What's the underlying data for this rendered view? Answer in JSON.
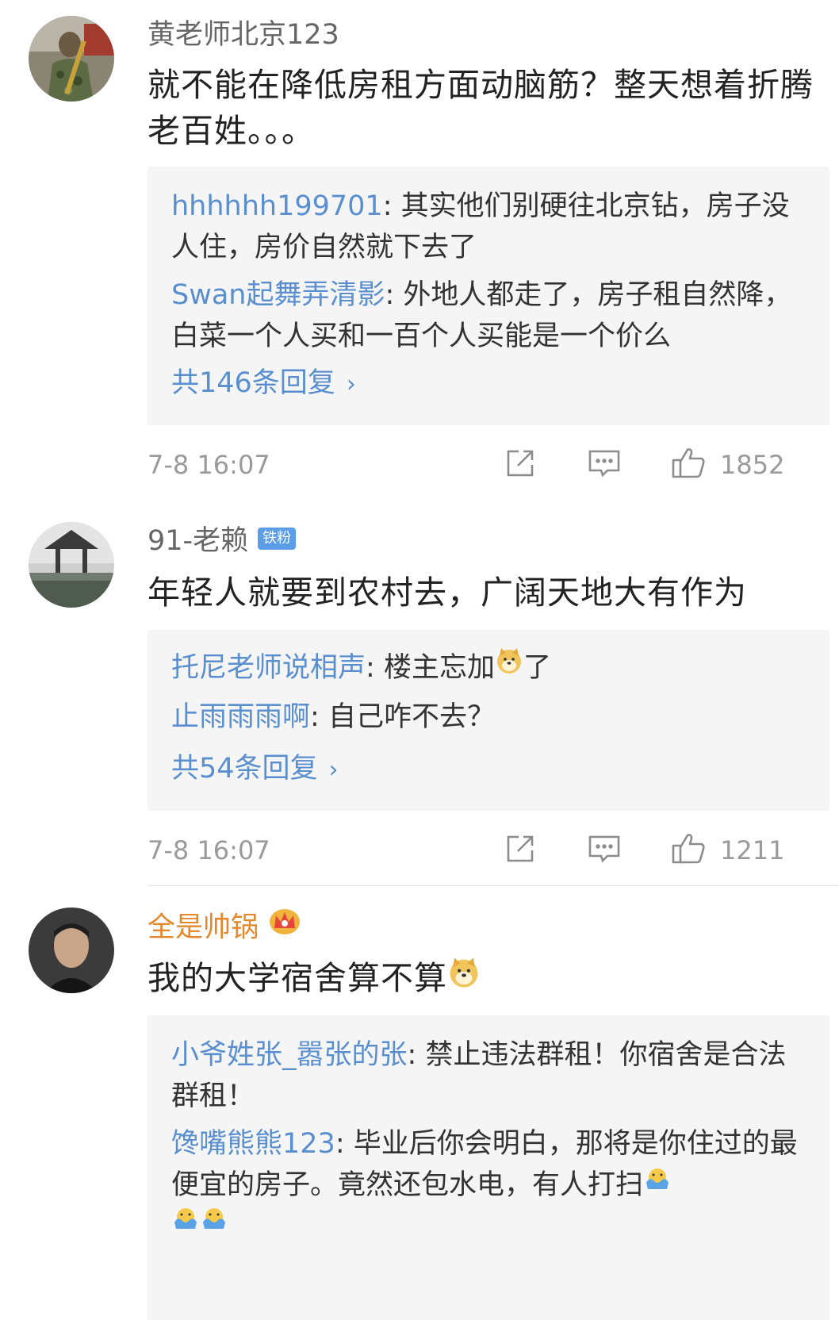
{
  "comments": [
    {
      "username": "黄老师北京123",
      "text": "就不能在降低房租方面动脑筋？整天想着折腾老百姓。。。",
      "replies": [
        {
          "author": "hhhhhh199701",
          "text": "其实他们别硬往北京钻，房子没人住，房价自然就下去了"
        },
        {
          "author": "Swan起舞弄清影",
          "text": "外地人都走了，房子租自然降，白菜一个人买和一百个人买能是一个价么"
        }
      ],
      "more_replies": "共146条回复",
      "timestamp": "7-8 16:07",
      "likes": "1852"
    },
    {
      "username": "91-老赖",
      "badge": "铁粉",
      "text": "年轻人就要到农村去，广阔天地大有作为",
      "replies": [
        {
          "author": "托尼老师说相声",
          "text_before": "楼主忘加",
          "text_after": "了"
        },
        {
          "author": "止雨雨雨啊",
          "text": "自己咋不去？"
        }
      ],
      "more_replies": "共54条回复",
      "timestamp": "7-8 16:07",
      "likes": "1211"
    },
    {
      "username": "全是帅锅",
      "text": "我的大学宿舍算不算",
      "replies": [
        {
          "author": "小爷姓张_嚣张的张",
          "text": "禁止违法群租！你宿舍是合法群租！"
        },
        {
          "author": "馋嘴熊熊123",
          "text": "毕业后你会明白，那将是你住过的最便宜的房子。竟然还包水电，有人打扫"
        }
      ]
    }
  ],
  "separator": ": ",
  "chevron": "›",
  "colors": {
    "link_blue": "#5a8fcf",
    "vip_orange": "#e5882b",
    "reply_bg": "#f5f5f5",
    "meta_gray": "#9a9a9a"
  },
  "icons": [
    "share-icon",
    "comment-icon",
    "like-icon",
    "crown-icon",
    "doge-emoji",
    "facepalm-emoji"
  ]
}
